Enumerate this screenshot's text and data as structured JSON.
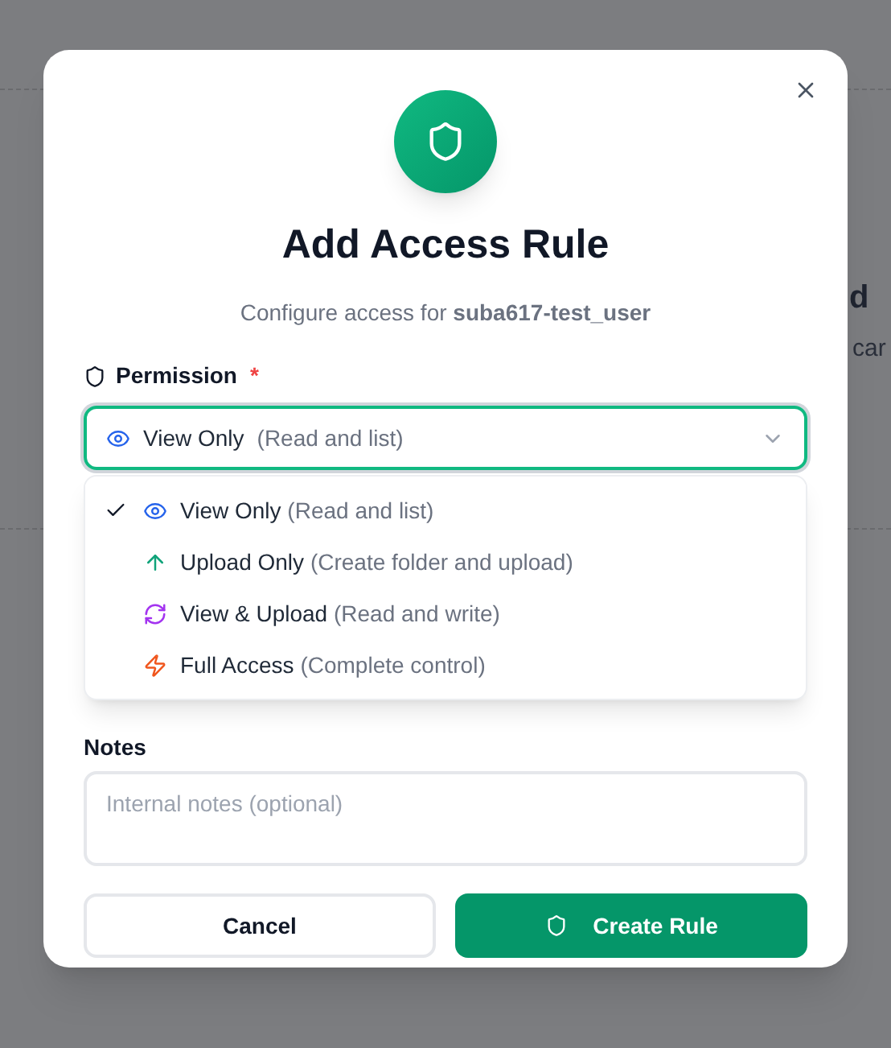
{
  "background": {
    "fragments": [
      "d",
      "car"
    ]
  },
  "dialog": {
    "title": "Add Access Rule",
    "subtitle": "Configure access for **suba617-test_user**"
  },
  "permission": {
    "label": "Permission",
    "required_mark": "*",
    "value": "View Only",
    "value_hint": "(Read and list)",
    "expanded": true,
    "options": [
      {
        "kind": "view",
        "label": "View Only",
        "hint": "(Read and list)",
        "selected": true
      },
      {
        "kind": "upload",
        "label": "Upload Only",
        "hint": "(Create folder and upload)",
        "selected": false
      },
      {
        "kind": "sync",
        "label": "View & Upload",
        "hint": "(Read and write)",
        "selected": false
      },
      {
        "kind": "full",
        "label": "Full Access",
        "hint": "(Complete control)",
        "selected": false
      }
    ]
  },
  "notes": {
    "label": "Notes",
    "placeholder": "Internal notes (optional)"
  },
  "buttons": {
    "cancel": "Cancel",
    "create": "Create Rule"
  }
}
